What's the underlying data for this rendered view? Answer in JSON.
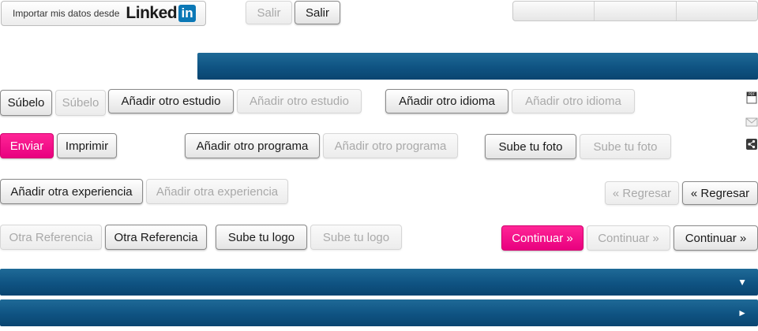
{
  "linkedin": {
    "label": "Importar mis datos desde",
    "brand": "Linked",
    "brand_in": "in"
  },
  "buttons": {
    "salir_disabled": "Salir",
    "salir": "Salir",
    "subelo": "Súbelo",
    "subelo_disabled": "Súbelo",
    "anadir_estudio": "Añadir otro estudio",
    "anadir_estudio_disabled": "Añadir otro estudio",
    "anadir_idioma": "Añadir otro idioma",
    "anadir_idioma_disabled": "Añadir otro idioma",
    "enviar": "Enviar",
    "imprimir": "Imprimir",
    "anadir_programa": "Añadir otro programa",
    "anadir_programa_disabled": "Añadir otro programa",
    "sube_foto": "Sube tu foto",
    "sube_foto_disabled": "Sube tu foto",
    "anadir_experiencia": "Añadir otra experiencia",
    "anadir_experiencia_disabled": "Añadir otra experiencia",
    "regresar_disabled": "« Regresar",
    "regresar": "« Regresar",
    "otra_referencia_disabled": "Otra Referencia",
    "otra_referencia": "Otra Referencia",
    "sube_logo": "Sube tu logo",
    "sube_logo_disabled": "Sube tu logo",
    "continuar_active": "Continuar »",
    "continuar_disabled": "Continuar »",
    "continuar": "Continuar »"
  },
  "bars": {
    "expanded_arrow": "▼",
    "collapsed_arrow": "►"
  },
  "icons": {
    "pdf": "pdf-icon",
    "mail": "mail-icon",
    "share": "share-icon"
  },
  "colors": {
    "accent_pink": "#ff2596",
    "bar_blue": "#0f5382"
  }
}
